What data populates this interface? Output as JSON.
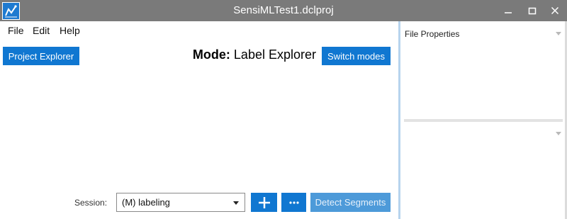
{
  "window": {
    "title": "SensiMLTest1.dclproj",
    "icon": "chart-line-icon",
    "controls": [
      "minimize-icon",
      "maximize-icon",
      "close-icon"
    ]
  },
  "menu": {
    "file": "File",
    "edit": "Edit",
    "help": "Help"
  },
  "toolbar": {
    "project_explorer": "Project Explorer",
    "mode_prefix": "Mode:",
    "mode_value": "Label Explorer",
    "switch_modes": "Switch modes"
  },
  "session": {
    "label": "Session:",
    "selected": "(M) labeling",
    "add_icon": "plus-icon",
    "more_icon": "ellipsis-icon",
    "detect_segments": "Detect Segments",
    "detect_enabled": false
  },
  "properties_panel": {
    "header": "File Properties"
  },
  "colors": {
    "titlebar": "#7a7a7a",
    "accent": "#1077d1",
    "accent_disabled": "#4d9ad9",
    "divider": "#b7d4ee"
  }
}
